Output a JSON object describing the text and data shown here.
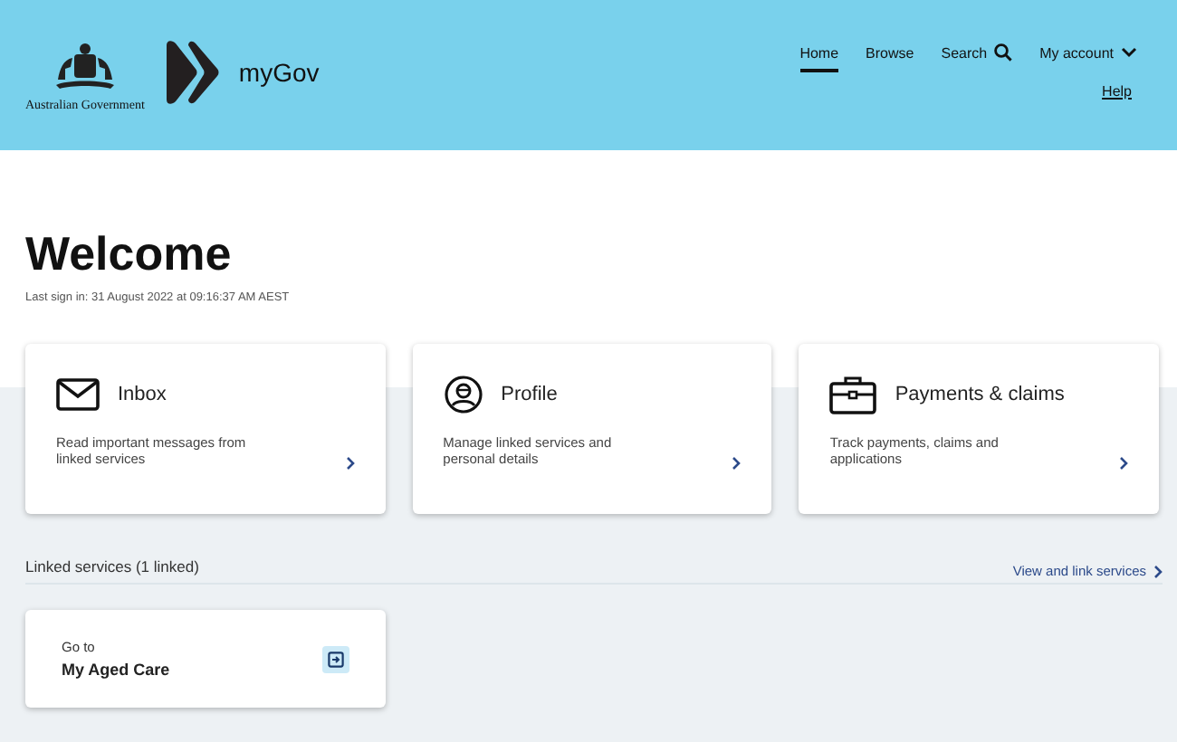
{
  "header": {
    "government": "Australian Government",
    "brand": "myGov",
    "nav": [
      {
        "label": "Home",
        "kind": "link",
        "selected": true
      },
      {
        "label": "Browse",
        "kind": "link",
        "selected": false
      },
      {
        "label": "Search",
        "kind": "search",
        "selected": false
      },
      {
        "label": "My account",
        "kind": "menu",
        "selected": false
      }
    ],
    "help": "Help"
  },
  "welcome": {
    "title": "Welcome",
    "last_sign_in": "Last sign in: 31 August 2022 at 09:16:37 AM AEST"
  },
  "cards": [
    {
      "kind": "inbox",
      "title": "Inbox",
      "description": "Read important messages from linked services"
    },
    {
      "kind": "profile",
      "title": "Profile",
      "description": "Manage linked services and personal details"
    },
    {
      "kind": "payments",
      "title": "Payments & claims",
      "description": "Track payments, claims and applications"
    }
  ],
  "linked": {
    "heading": "Linked services (1 linked)",
    "link": "View and link services",
    "services": [
      {
        "prefix": "Go to",
        "name": "My Aged Care"
      }
    ]
  }
}
